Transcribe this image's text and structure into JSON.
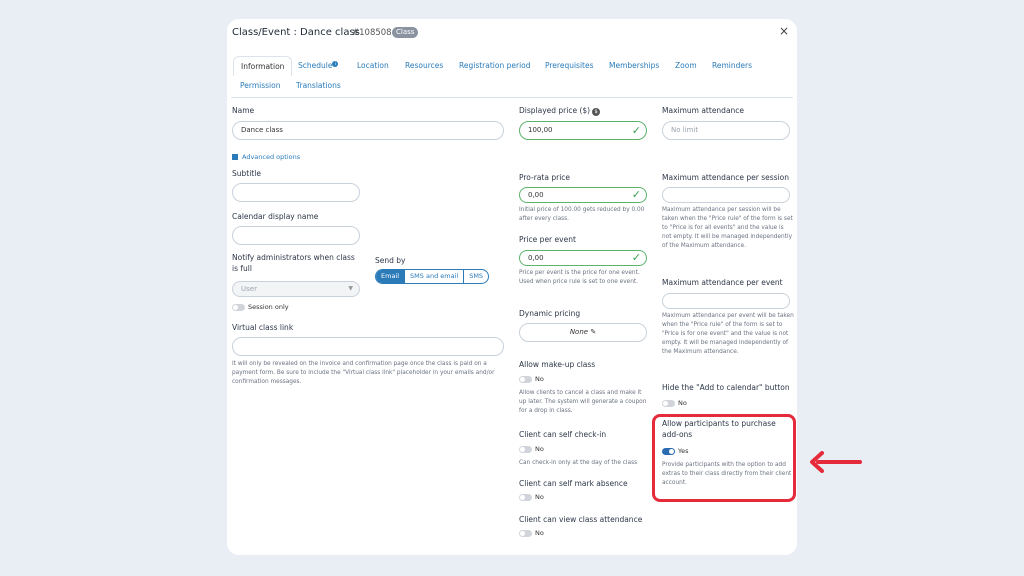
{
  "header": {
    "title": "Class/Event : Dance class",
    "id": "#108508",
    "badge": "Class",
    "close": "×"
  },
  "tabs": [
    {
      "label": "Information",
      "active": true
    },
    {
      "label": "Schedule"
    },
    {
      "label": "Location"
    },
    {
      "label": "Resources"
    },
    {
      "label": "Registration period"
    },
    {
      "label": "Prerequisites"
    },
    {
      "label": "Memberships"
    },
    {
      "label": "Zoom"
    },
    {
      "label": "Reminders"
    },
    {
      "label": "Permission"
    },
    {
      "label": "Translations"
    }
  ],
  "col1": {
    "name_label": "Name",
    "name_value": "Dance class",
    "advanced": "Advanced options",
    "subtitle_label": "Subtitle",
    "calendar_name_label": "Calendar display name",
    "notify_label": "Notify administrators when class is full",
    "notify_placeholder": "User",
    "send_by_label": "Send by",
    "send_by_options": [
      "Email",
      "SMS and email",
      "SMS"
    ],
    "session_only": "Session only",
    "virtual_label": "Virtual class link",
    "virtual_help": "It will only be revealed on the invoice and confirmation page once the class is paid on a payment form. Be sure to include the \"Virtual class link\" placeholder in your emails and/or confirmation messages."
  },
  "col2": {
    "price_label": "Displayed price ($)",
    "price_value": "100,00",
    "prorata_label": "Pro-rata price",
    "prorata_value": "0,00",
    "prorata_help": "Initial price of 100.00 gets reduced by 0.00 after every class.",
    "per_event_label": "Price per event",
    "per_event_value": "0,00",
    "per_event_help": "Price per event is the price for one event. Used when price rule is set to one event.",
    "dynamic_label": "Dynamic pricing",
    "dynamic_value": "None",
    "makeup_label": "Allow make-up class",
    "makeup_toggle": "No",
    "makeup_help": "Allow clients to cancel a class and make it up later. The system will generate a coupon for a drop in class.",
    "checkin_label": "Client can self check-in",
    "checkin_toggle": "No",
    "checkin_help": "Can check-in only at the day of the class",
    "absence_label": "Client can self mark absence",
    "absence_toggle": "No",
    "attendance_label": "Client can view class attendance",
    "attendance_toggle": "No"
  },
  "col3": {
    "max_label": "Maximum attendance",
    "max_placeholder": "No limit",
    "max_session_label": "Maximum attendance per session",
    "max_session_help": "Maximum attendance per session will be taken when the \"Price rule\" of the form is set to \"Price is for all events\" and the value is not empty. It will be managed independently of the Maximum attendance.",
    "max_event_label": "Maximum attendance per event",
    "max_event_help": "Maximum attendance per event will be taken when the \"Price rule\" of the form is set to \"Price is for one event\" and the value is not empty. It will be managed independently of the Maximum attendance.",
    "hide_cal_label": "Hide the \"Add to calendar\" button",
    "hide_cal_toggle": "No",
    "addons_label": "Allow participants to purchase add-ons",
    "addons_toggle": "Yes",
    "addons_help": "Provide participants with the option to add extras to their class directly from their client account."
  },
  "colors": {
    "accent": "#2b7bb9",
    "success": "#3ea34f",
    "highlight": "#e52b3b"
  }
}
